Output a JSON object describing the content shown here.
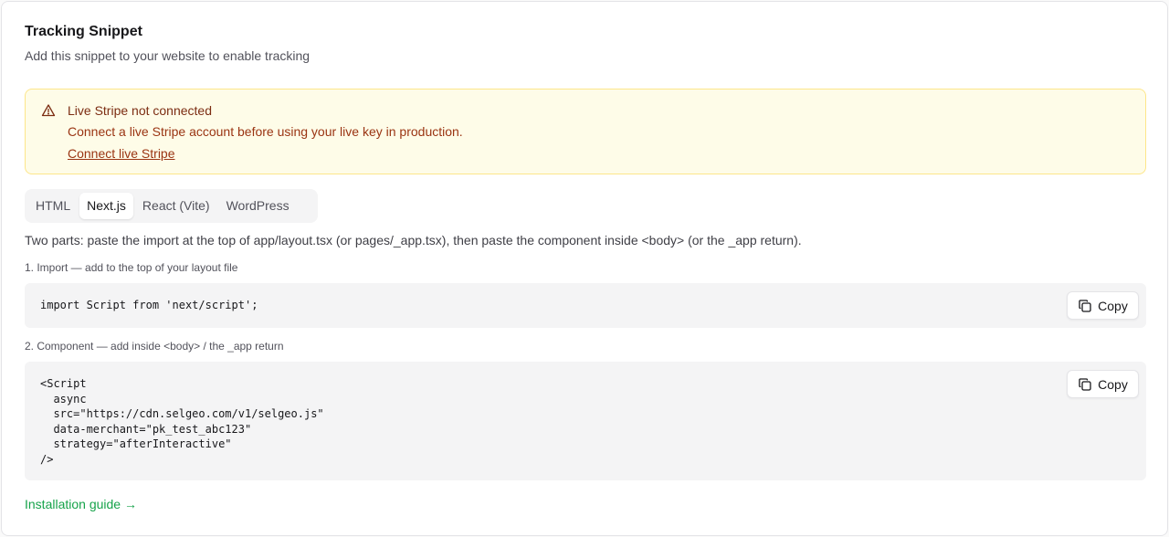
{
  "header": {
    "title": "Tracking Snippet",
    "subtitle": "Add this snippet to your website to enable tracking"
  },
  "alert": {
    "icon": "warning-triangle-icon",
    "title": "Live Stripe not connected",
    "description": "Connect a live Stripe account before using your live key in production.",
    "link_label": "Connect live Stripe",
    "colors": {
      "background": "#fefce8",
      "border": "#fde68a",
      "text": "#9a3412"
    }
  },
  "tabs": [
    {
      "label": "HTML",
      "active": false
    },
    {
      "label": "Next.js",
      "active": true
    },
    {
      "label": "React (Vite)",
      "active": false
    },
    {
      "label": "WordPress",
      "active": false
    }
  ],
  "instructions": "Two parts: paste the import at the top of app/layout.tsx (or pages/_app.tsx), then paste the component inside <body> (or the _app return).",
  "steps": [
    {
      "label": "1. Import — add to the top of your layout file",
      "code": "import Script from 'next/script';",
      "copy_label": "Copy"
    },
    {
      "label": "2. Component — add inside <body> / the _app return",
      "code": "<Script\n  async\n  src=\"https://cdn.selgeo.com/v1/selgeo.js\"\n  data-merchant=\"pk_test_abc123\"\n  strategy=\"afterInteractive\"\n/>",
      "copy_label": "Copy"
    }
  ],
  "footer": {
    "guide_link": "Installation guide →",
    "accent": "#16a34a"
  }
}
